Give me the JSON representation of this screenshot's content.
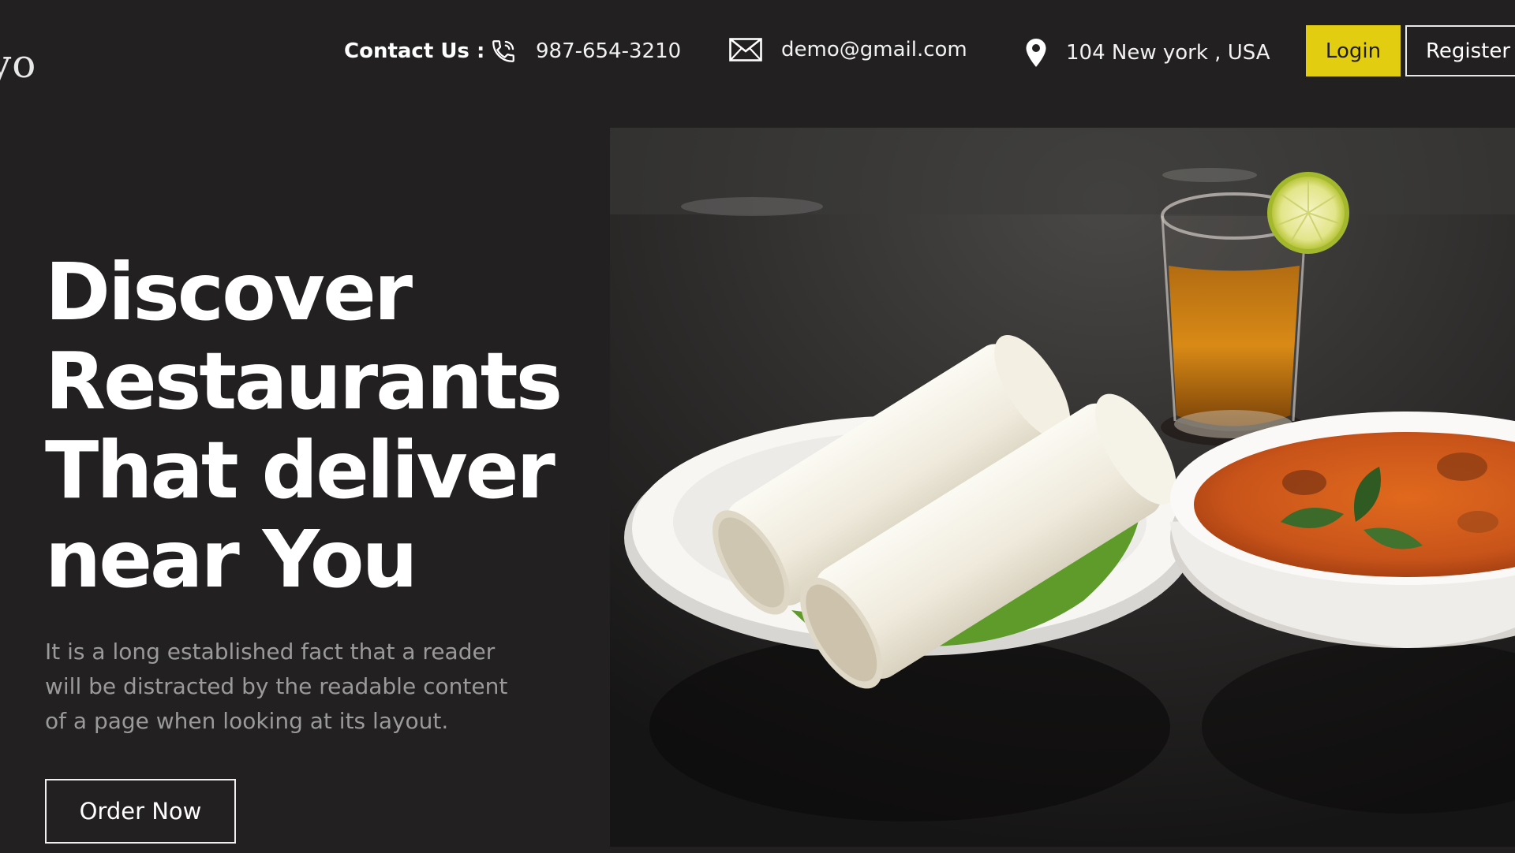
{
  "header": {
    "logo_text": "yo",
    "contact_label": "Contact Us :",
    "phone": "987-654-3210",
    "email": "demo@gmail.com",
    "address": "104 New york , USA",
    "login_label": "Login",
    "register_label": "Register",
    "icons": {
      "phone": "phone-icon",
      "email": "envelope-icon",
      "address": "map-pin-icon"
    }
  },
  "hero": {
    "title_lines": [
      "Discover",
      "Restaurants",
      "That deliver",
      "near You"
    ],
    "description": "It is a long established fact that a reader will be distracted by the readable content of a page when looking at its layout.",
    "order_button_label": "Order Now",
    "image_subject": "food-photo"
  },
  "colors": {
    "background": "#222021",
    "accent": "#e2cd11",
    "text": "#ffffff",
    "muted_text": "#9a9a9a"
  }
}
